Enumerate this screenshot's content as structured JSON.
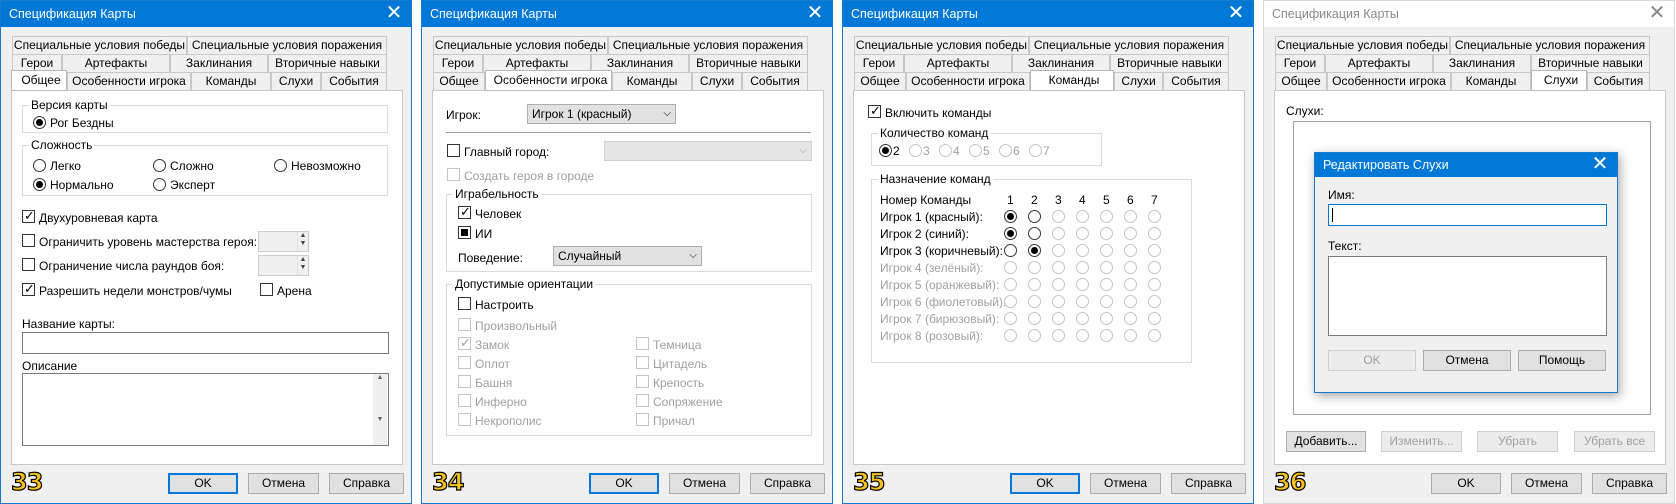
{
  "d33": {
    "title": "Спецификация Карты",
    "tabs": [
      "Специальные условия победы",
      "Специальные условия поражения",
      "Герои",
      "Артефакты",
      "Заклинания",
      "Вторичные навыки",
      "Общее",
      "Особенности игрока",
      "Команды",
      "Слухи",
      "События"
    ],
    "version_label": "Версия карты",
    "version_value": "Рог Бездны",
    "difficulty_label": "Сложность",
    "difficulty_options": [
      "Легко",
      "Сложно",
      "Невозможно",
      "Нормально",
      "Эксперт"
    ],
    "two_level": "Двухуровневая карта",
    "limit_mastery": "Ограничить уровень мастерства героя:",
    "limit_rounds": "Ограничение числа раундов боя:",
    "allow_weeks": "Разрешить недели монстров/чумы",
    "arena": "Арена",
    "map_name_label": "Название карты:",
    "map_name_value": "",
    "description_label": "Описание",
    "description_value": "",
    "badge": "33"
  },
  "d34": {
    "title": "Спецификация Карты",
    "tabs": [
      "Специальные условия победы",
      "Специальные условия поражения",
      "Герои",
      "Артефакты",
      "Заклинания",
      "Вторичные навыки",
      "Общее",
      "Особенности игрока",
      "Команды",
      "Слухи",
      "События"
    ],
    "player_label": "Игрок:",
    "player_value": "Игрок 1 (красный)",
    "main_town": "Главный город:",
    "create_hero": "Создать героя в городе",
    "playability_label": "Играбельность",
    "human": "Человек",
    "ai": "ИИ",
    "behavior_label": "Поведение:",
    "behavior_value": "Случайный",
    "orient_label": "Допустимые ориентации",
    "customize": "Настроить",
    "random": "Произвольный",
    "towns_left": [
      "Замок",
      "Оплот",
      "Башня",
      "Инферно",
      "Некрополис"
    ],
    "towns_right": [
      "Темница",
      "Цитадель",
      "Крепость",
      "Сопряжение",
      "Причал"
    ],
    "badge": "34"
  },
  "d35": {
    "title": "Спецификация Карты",
    "tabs": [
      "Специальные условия победы",
      "Специальные условия поражения",
      "Герои",
      "Артефакты",
      "Заклинания",
      "Вторичные навыки",
      "Общее",
      "Особенности игрока",
      "Команды",
      "Слухи",
      "События"
    ],
    "enable_teams": "Включить команды",
    "count_label": "Количество команд",
    "count_options": [
      "2",
      "3",
      "4",
      "5",
      "6",
      "7"
    ],
    "assign_label": "Назначение команд",
    "team_num_label": "Номер Команды",
    "team_cols": [
      "1",
      "2",
      "3",
      "4",
      "5",
      "6",
      "7"
    ],
    "players": [
      "Игрок 1 (красный):",
      "Игрок 2 (синий):",
      "Игрок 3 (коричневый):",
      "Игрок 4 (зелёный):",
      "Игрок 5 (оранжевый):",
      "Игрок 6 (фиолетовый):",
      "Игрок 7 (бирюзовый):",
      "Игрок 8 (розовый):"
    ],
    "badge": "35"
  },
  "d36": {
    "title": "Спецификация Карты",
    "tabs": [
      "Специальные условия победы",
      "Специальные условия поражения",
      "Герои",
      "Артефакты",
      "Заклинания",
      "Вторичные навыки",
      "Общее",
      "Особенности игрока",
      "Команды",
      "Слухи",
      "События"
    ],
    "rumors_label": "Слухи:",
    "add": "Добавить...",
    "edit": "Изменить...",
    "remove": "Убрать",
    "remove_all": "Убрать все",
    "badge": "36"
  },
  "popup": {
    "title": "Редактировать Слухи",
    "name_label": "Имя:",
    "name_value": "",
    "text_label": "Текст:",
    "text_value": "",
    "ok": "OK",
    "cancel": "Отмена",
    "help": "Помощь"
  },
  "buttons": {
    "ok": "OK",
    "cancel": "Отмена",
    "help": "Справка"
  },
  "icons": {
    "close": "close-icon",
    "check": "check-icon",
    "dropdown": "chevron-down-icon",
    "spin": "spin-arrows-icon"
  }
}
